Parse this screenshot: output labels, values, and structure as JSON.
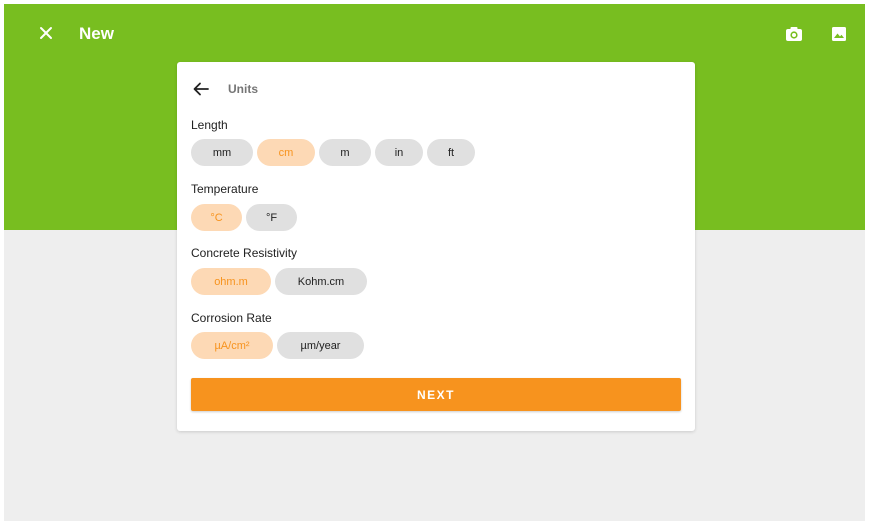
{
  "appbar": {
    "title": "New",
    "color": "#78be20"
  },
  "icons": {
    "close": "close-icon",
    "camera": "camera-icon",
    "gallery": "image-icon",
    "back": "arrow-back-icon"
  },
  "card": {
    "title": "Units",
    "sections": [
      {
        "label": "Length",
        "options": [
          "mm",
          "cm",
          "m",
          "in",
          "ft"
        ],
        "selected": "cm"
      },
      {
        "label": "Temperature",
        "options": [
          "°C",
          "°F"
        ],
        "selected": "°C"
      },
      {
        "label": "Concrete Resistivity",
        "options": [
          "ohm.m",
          "Kohm.cm"
        ],
        "selected": "ohm.m"
      },
      {
        "label": "Corrosion Rate",
        "options": [
          "µA/cm²",
          "µm/year"
        ],
        "selected": "µA/cm²"
      }
    ],
    "next_label": "NEXT"
  },
  "colors": {
    "accent": "#f7931e",
    "selected_chip_bg": "#fdd9b5",
    "chip_bg": "#e0e0e0"
  }
}
